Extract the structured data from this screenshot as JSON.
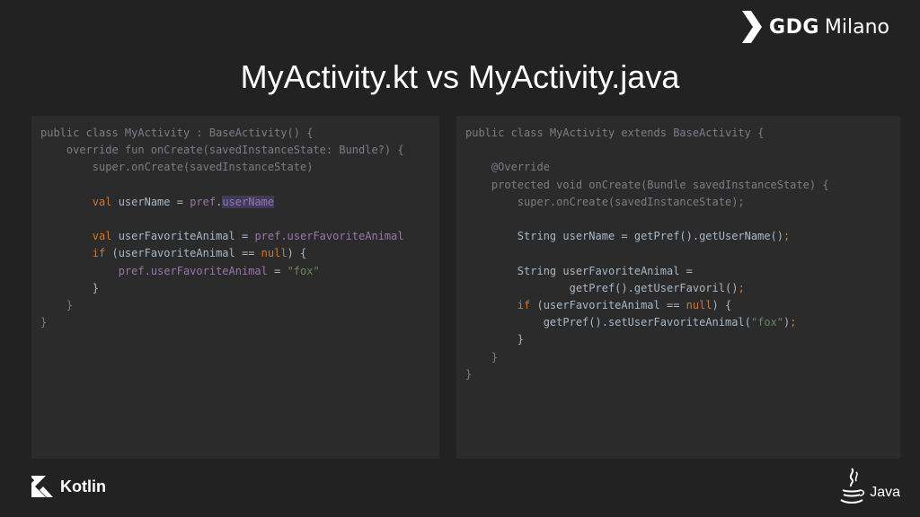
{
  "brand": {
    "gdg": "GDG",
    "city": "Milano"
  },
  "title": "MyActivity.kt vs MyActivity.java",
  "kotlin_code": [
    {
      "text": "public class MyActivity : BaseActivity() {",
      "cls": "dim"
    },
    {
      "text": "    override fun onCreate(savedInstanceState: Bundle?) {",
      "cls": "dim"
    },
    {
      "text": "        super.onCreate(savedInstanceState)",
      "cls": "dim"
    },
    {
      "text": ""
    },
    {
      "text": "        val userName = pref.userName",
      "cls": "kt-username"
    },
    {
      "text": ""
    },
    {
      "text": "        val userFavoriteAnimal = pref.userFavoriteAnimal",
      "cls": "kt-animal"
    },
    {
      "text": "        if (userFavoriteAnimal == null) {",
      "cls": "kt-if"
    },
    {
      "text": "            pref.userFavoriteAnimal = \"fox\"",
      "cls": "kt-assign"
    },
    {
      "text": "        }"
    },
    {
      "text": "    }",
      "cls": "dim"
    },
    {
      "text": "}",
      "cls": "dim"
    }
  ],
  "java_code": [
    {
      "text": "public class MyActivity extends BaseActivity {",
      "cls": "dim"
    },
    {
      "text": ""
    },
    {
      "text": "    @Override",
      "cls": "dim"
    },
    {
      "text": "    protected void onCreate(Bundle savedInstanceState) {",
      "cls": "dim"
    },
    {
      "text": "        super.onCreate(savedInstanceState);",
      "cls": "dim"
    },
    {
      "text": ""
    },
    {
      "text": "        String userName = getPref().getUserName();",
      "cls": "java-semi"
    },
    {
      "text": ""
    },
    {
      "text": "        String userFavoriteAnimal ="
    },
    {
      "text": "                getPref().getUserFavoril();",
      "cls": "java-semi"
    },
    {
      "text": "        if (userFavoriteAnimal == null) {",
      "cls": "java-if"
    },
    {
      "text": "            getPref().setUserFavoriteAnimal(\"fox\");",
      "cls": "java-set"
    },
    {
      "text": "        }"
    },
    {
      "text": "    }",
      "cls": "dim"
    },
    {
      "text": "}",
      "cls": "dim"
    }
  ],
  "footer": {
    "kotlin": "Kotlin",
    "java": "Java"
  },
  "colors": {
    "background": "#222222",
    "panel": "#2b2b2b",
    "keyword": "#cc7832",
    "property": "#9876aa",
    "string": "#6a8759"
  }
}
